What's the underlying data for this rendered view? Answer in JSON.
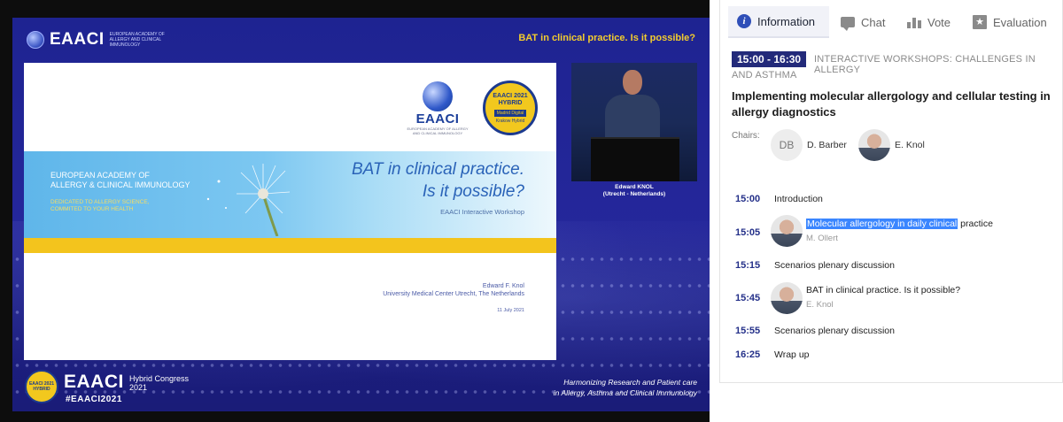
{
  "video": {
    "brand": "EAACI",
    "brand_sub": "EUROPEAN ACADEMY OF ALLERGY AND CLINICAL IMMUNOLOGY",
    "top_title": "BAT in clinical practice. Is it possible?",
    "slide": {
      "logo_text": "EAACI",
      "logo_sub": "EUROPEAN ACADEMY OF ALLERGY AND CLINICAL IMMUNOLOGY",
      "badge_line1": "EAACI 2021",
      "badge_line2": "HYBRID",
      "badge_line3": "Madrid Digital",
      "badge_line4": "Krakow Hybrid",
      "org_line1": "EUROPEAN ACADEMY OF",
      "org_line2": "ALLERGY & CLINICAL IMMUNOLOGY",
      "tag_line1": "DEDICATED TO ALLERGY SCIENCE,",
      "tag_line2": "COMMITED TO YOUR HEALTH",
      "title_line1": "BAT in clinical practice.",
      "title_line2": "Is it possible?",
      "workshop": "EAACI Interactive Workshop",
      "author": "Edward F. Knol",
      "affiliation": "University Medical Center Utrecht, The Netherlands",
      "date": "11 July 2021"
    },
    "speaker_name": "Edward KNOL",
    "speaker_location": "(Utrecht - Netherlands)",
    "footer": {
      "badge": "EAACI 2021 HYBRID",
      "brand": "EAACI",
      "hybrid_line1": "Hybrid Congress",
      "hybrid_line2": "2021",
      "hashtag": "#EAACI2021",
      "right_line1": "Harmonizing Research and Patient care",
      "right_line2": "in Allergy, Asthma and Clinical Immunology"
    }
  },
  "panel": {
    "tabs": [
      {
        "label": "Information",
        "icon": "info-icon",
        "active": true
      },
      {
        "label": "Chat",
        "icon": "chat-icon"
      },
      {
        "label": "Vote",
        "icon": "vote-icon"
      },
      {
        "label": "Evaluation",
        "icon": "evaluation-star-icon"
      }
    ],
    "session": {
      "time": "15:00 - 16:30",
      "type_line1": "INTERACTIVE WORKSHOPS: CHALLENGES IN ALLERGY",
      "type_line2": "AND ASTHMA",
      "title": "Implementing molecular allergology and cellular testing in allergy diagnostics"
    },
    "chairs_label": "Chairs:",
    "chairs": [
      {
        "initials": "DB",
        "name": "D. Barber"
      },
      {
        "name": "E. Knol"
      }
    ],
    "timetable": [
      {
        "time": "15:00",
        "title": "Introduction"
      },
      {
        "time": "15:05",
        "title_highlight": "Molecular allergology in daily clinical",
        "title_rest": " practice",
        "speaker": "M. Ollert"
      },
      {
        "time": "15:15",
        "title": "Scenarios plenary discussion"
      },
      {
        "time": "15:45",
        "title": "BAT in clinical practice. Is it possible?",
        "speaker": "E. Knol"
      },
      {
        "time": "15:55",
        "title": "Scenarios plenary discussion"
      },
      {
        "time": "16:25",
        "title": "Wrap up"
      }
    ]
  }
}
